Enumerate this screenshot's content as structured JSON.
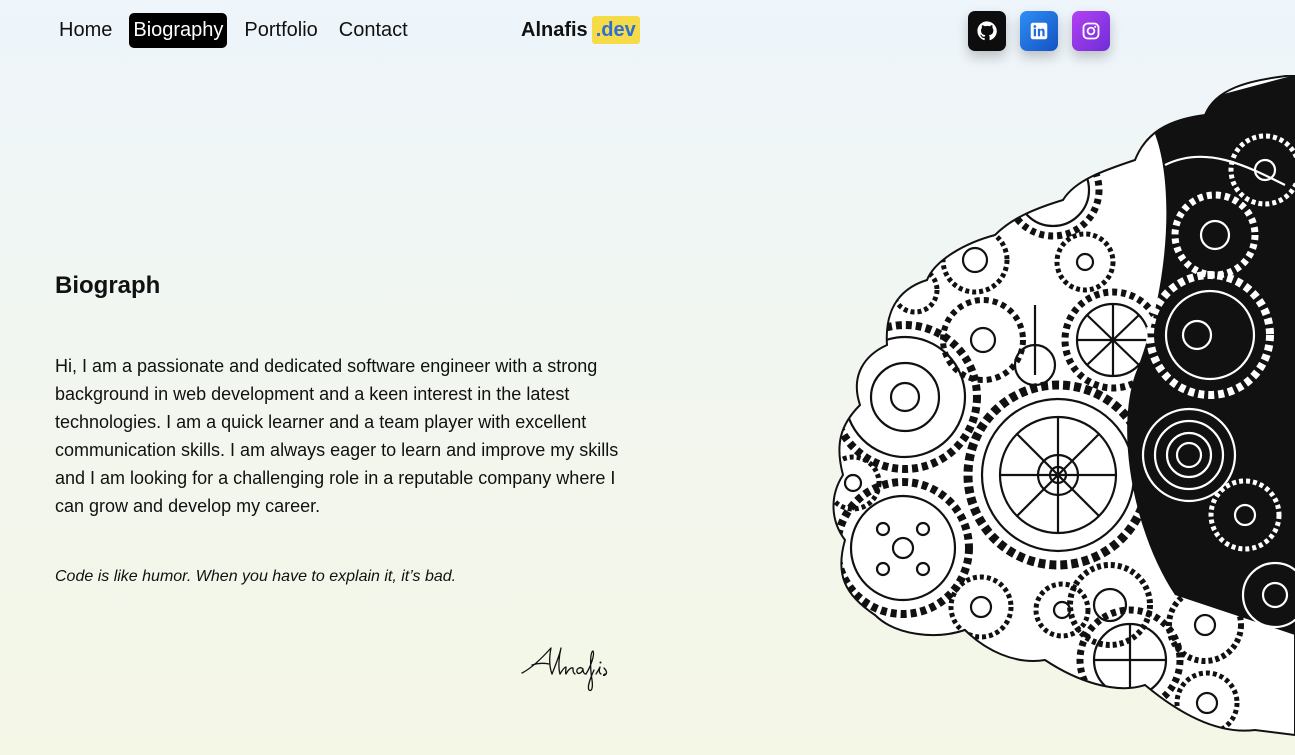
{
  "nav": {
    "items": [
      {
        "label": "Home",
        "active": false
      },
      {
        "label": "Biography",
        "active": true
      },
      {
        "label": "Portfolio",
        "active": false
      },
      {
        "label": "Contact",
        "active": false
      }
    ]
  },
  "logo": {
    "name": "Alnafis",
    "tld": ".dev"
  },
  "social": [
    {
      "icon": "github-icon",
      "color": "#0d0d0d"
    },
    {
      "icon": "linkedin-icon",
      "color": "#1f6fe0"
    },
    {
      "icon": "instagram-icon",
      "color": "#9b3cf0"
    }
  ],
  "main": {
    "title": "Biograph",
    "bio": "Hi, I am a passionate and dedicated software engineer with a strong background in web development and a keen interest in the latest technologies. I am a quick learner and a team player with excellent communication skills. I am always eager to learn and improve my skills and I am looking for a challenging role in a reputable company where I can grow and develop my career.",
    "quote": "Code is like humor. When you have to explain it, it’s bad.",
    "signature": "Alnafis"
  },
  "illustration": {
    "icon": "brain-gears-illustration"
  },
  "colors": {
    "accent_yellow": "#f5db48",
    "accent_blue": "#2d6fd8",
    "active_nav_bg": "#000000"
  }
}
